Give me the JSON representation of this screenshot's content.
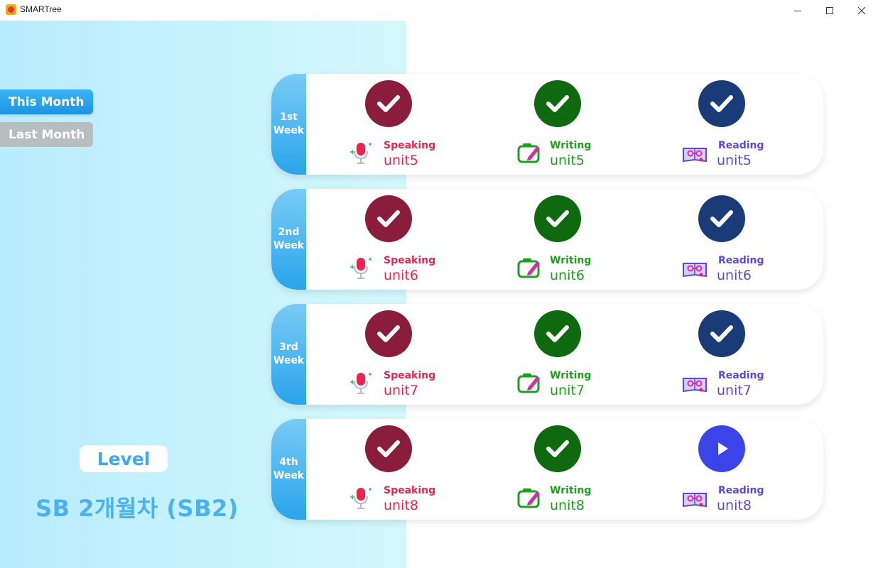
{
  "window": {
    "title": "SMARTree"
  },
  "sidebar": {
    "this_month": "This Month",
    "last_month": "Last Month",
    "level_label": "Level",
    "level_name": "SB 2개월차 (SB2)"
  },
  "colors": {
    "speaking": "#8b1d3c",
    "writing": "#0f6a0f",
    "reading": "#1a3a78",
    "reading_play": "#3a44e8",
    "accent": "#2aa4ec"
  },
  "weeks": [
    {
      "label_line1": "1st",
      "label_line2": "Week",
      "speaking": {
        "label": "Speaking",
        "unit": "unit5",
        "status": "completed"
      },
      "writing": {
        "label": "Writing",
        "unit": "unit5",
        "status": "completed"
      },
      "reading": {
        "label": "Reading",
        "unit": "unit5",
        "status": "completed"
      }
    },
    {
      "label_line1": "2nd",
      "label_line2": "Week",
      "speaking": {
        "label": "Speaking",
        "unit": "unit6",
        "status": "completed"
      },
      "writing": {
        "label": "Writing",
        "unit": "unit6",
        "status": "completed"
      },
      "reading": {
        "label": "Reading",
        "unit": "unit6",
        "status": "completed"
      }
    },
    {
      "label_line1": "3rd",
      "label_line2": "Week",
      "speaking": {
        "label": "Speaking",
        "unit": "unit7",
        "status": "completed"
      },
      "writing": {
        "label": "Writing",
        "unit": "unit7",
        "status": "completed"
      },
      "reading": {
        "label": "Reading",
        "unit": "unit7",
        "status": "completed"
      }
    },
    {
      "label_line1": "4th",
      "label_line2": "Week",
      "speaking": {
        "label": "Speaking",
        "unit": "unit8",
        "status": "completed"
      },
      "writing": {
        "label": "Writing",
        "unit": "unit8",
        "status": "completed"
      },
      "reading": {
        "label": "Reading",
        "unit": "unit8",
        "status": "play"
      }
    }
  ]
}
